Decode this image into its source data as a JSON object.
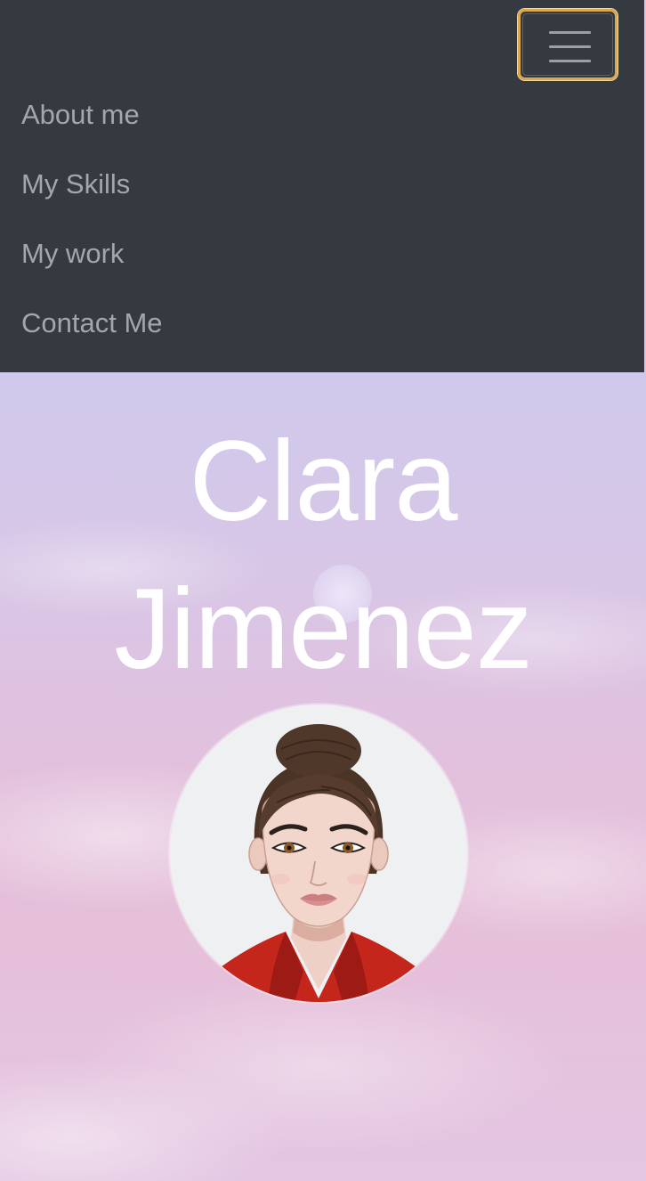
{
  "navbar": {
    "toggler_icon": "hamburger-icon",
    "items": [
      {
        "label": "About me"
      },
      {
        "label": "My Skills"
      },
      {
        "label": "My work"
      },
      {
        "label": "Contact Me"
      }
    ],
    "colors": {
      "background": "#343a40",
      "link": "#a3a7ac",
      "toggler_focus": "#e0a84a"
    }
  },
  "hero": {
    "name_first": "Clara",
    "name_last": "Jimenez",
    "avatar_icon": "woman-avatar-illustration"
  }
}
